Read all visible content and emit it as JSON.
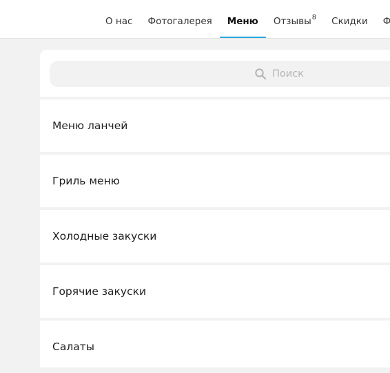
{
  "nav": {
    "tabs": [
      {
        "label": "О нас"
      },
      {
        "label": "Фотогалерея"
      },
      {
        "label": "Меню",
        "active": true
      },
      {
        "label": "Отзывы",
        "badge": "8"
      },
      {
        "label": "Скидки"
      },
      {
        "label": "Фото"
      }
    ],
    "accent_color": "#25a7e0"
  },
  "search": {
    "placeholder": "Поиск",
    "icon": "search-icon"
  },
  "menu": {
    "items": [
      {
        "label": "Меню ланчей"
      },
      {
        "label": "Гриль меню"
      },
      {
        "label": "Холодные закуски"
      },
      {
        "label": "Горячие закуски"
      },
      {
        "label": "Салаты"
      }
    ]
  }
}
